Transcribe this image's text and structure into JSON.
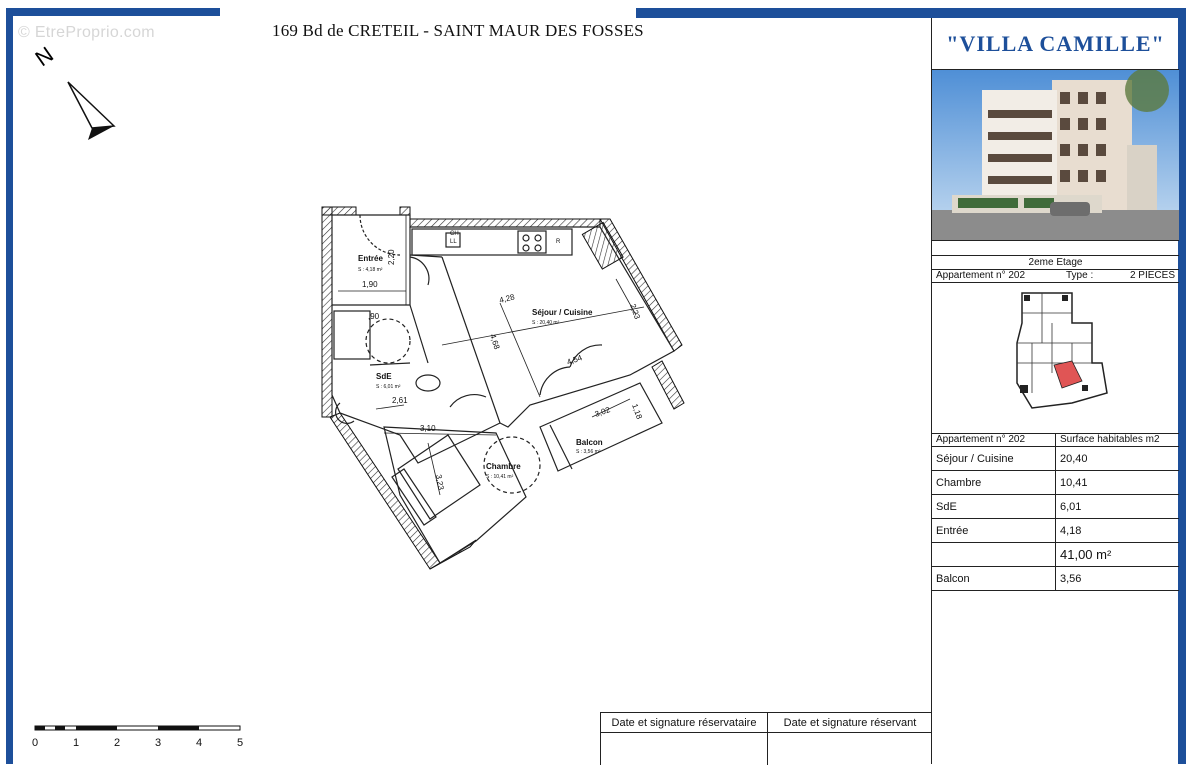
{
  "watermark": "© EtreProprio.com",
  "header": {
    "address": "169 Bd de CRETEIL - SAINT MAUR DES FOSSES"
  },
  "compass": {
    "letter": "N"
  },
  "plan": {
    "rooms": {
      "entree": {
        "name": "Entrée",
        "area": "S : 4,18 m²"
      },
      "sejour": {
        "name": "Séjour / Cuisine",
        "area": "S : 20,40 m²"
      },
      "sde": {
        "name": "SdE",
        "area": "S : 6,01 m²"
      },
      "chambre": {
        "name": "Chambre",
        "area": "S : 10,41 m²"
      },
      "balcon": {
        "name": "Balcon",
        "area": "S : 3,56 m²"
      }
    },
    "dimensions": [
      "2,20",
      "1,90",
      ",90",
      "4,28",
      "2,23",
      "4,68",
      "4,54",
      "2,61",
      "3,10",
      "3,23",
      "3,02",
      "1,18"
    ],
    "kitchen_labels": {
      "ch": "CH",
      "ll": "LL",
      "r": "R"
    }
  },
  "scale": {
    "ticks": [
      "0",
      "1",
      "2",
      "3",
      "4",
      "5"
    ]
  },
  "panel": {
    "title": "\"VILLA CAMILLE\"",
    "floor": "2eme Etage",
    "apartment_label": "Appartement n° 202",
    "type_label": "Type :",
    "type_value": "2 PIECES",
    "table_header": {
      "left": "Appartement n° 202",
      "right": "Surface habitables m2"
    },
    "rows": [
      {
        "room": "Séjour / Cuisine",
        "area": "20,40"
      },
      {
        "room": "Chambre",
        "area": "10,41"
      },
      {
        "room": "SdE",
        "area": "6,01"
      },
      {
        "room": "Entrée",
        "area": "4,18"
      }
    ],
    "total": "41,00 m²",
    "balcon": {
      "room": "Balcon",
      "area": "3,56"
    }
  },
  "signature": {
    "reservataire": "Date et signature réservataire",
    "reservant": "Date et signature réservant"
  },
  "colors": {
    "brand_blue": "#1d4f9a",
    "highlight_red": "#e05555"
  }
}
